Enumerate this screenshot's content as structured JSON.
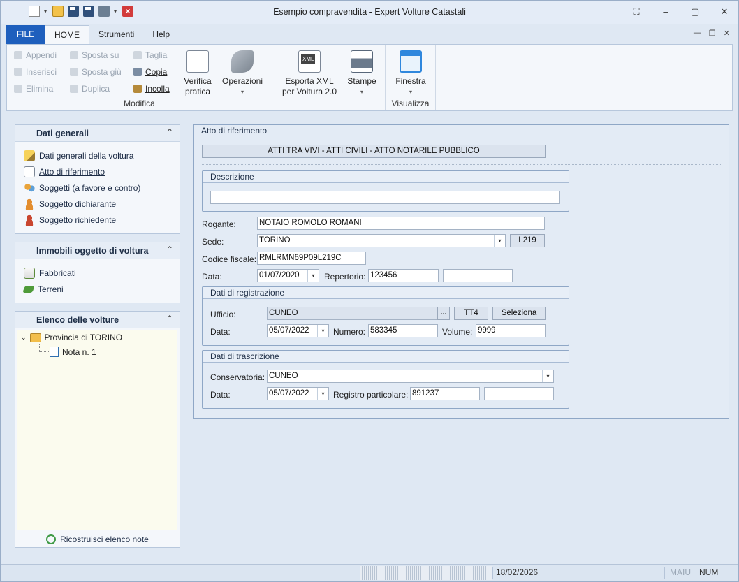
{
  "window": {
    "title": "Esempio compravendita - Expert Volture Catastali"
  },
  "ribbon_tabs": [
    "FILE",
    "HOME",
    "Strumenti",
    "Help"
  ],
  "ribbon": {
    "modifica": {
      "label": "Modifica",
      "appendi": "Appendi",
      "inserisci": "Inserisci",
      "elimina": "Elimina",
      "sposta_su": "Sposta su",
      "sposta_giu": "Sposta giù",
      "duplica": "Duplica",
      "taglia": "Taglia",
      "copia": "Copia",
      "incolla": "Incolla",
      "verifica_1": "Verifica",
      "verifica_2": "pratica",
      "operazioni": "Operazioni"
    },
    "export": {
      "esporta_1": "Esporta XML",
      "esporta_2": "per Voltura 2.0",
      "stampe": "Stampe"
    },
    "visualizza": {
      "label": "Visualizza",
      "finestra": "Finestra"
    }
  },
  "left_pane": {
    "dati_generali": {
      "title": "Dati generali",
      "items": [
        "Dati generali della voltura",
        "Atto di riferimento",
        "Soggetti (a favore e contro)",
        "Soggetto dichiarante",
        "Soggetto richiedente"
      ]
    },
    "immobili": {
      "title": "Immobili oggetto di voltura",
      "items": [
        "Fabbricati",
        "Terreni"
      ]
    },
    "elenco": {
      "title": "Elenco delle volture",
      "province": "Provincia di TORINO",
      "note": "Nota n. 1",
      "rebuild": "Ricostruisci elenco note"
    }
  },
  "form": {
    "section_title": "Atto di riferimento",
    "atto_type": "ATTI TRA VIVI - ATTI CIVILI - ATTO NOTARILE PUBBLICO",
    "descrizione": {
      "legend": "Descrizione",
      "value": ""
    },
    "rogante": {
      "label": "Rogante:",
      "value": "NOTAIO ROMOLO ROMANI"
    },
    "sede": {
      "label": "Sede:",
      "value": "TORINO",
      "code": "L219"
    },
    "codice_fiscale": {
      "label": "Codice fiscale:",
      "value": "RMLRMN69P09L219C"
    },
    "data": {
      "label": "Data:",
      "value": "01/07/2020"
    },
    "repertorio": {
      "label": "Repertorio:",
      "value": "123456",
      "extra": ""
    },
    "registrazione": {
      "legend": "Dati di registrazione",
      "ufficio_label": "Ufficio:",
      "ufficio": "CUNEO",
      "ellipsis": "···",
      "code": "TT4",
      "seleziona": "Seleziona",
      "data_label": "Data:",
      "data": "05/07/2022",
      "numero_label": "Numero:",
      "numero": "583345",
      "volume_label": "Volume:",
      "volume": "9999"
    },
    "trascrizione": {
      "legend": "Dati di trascrizione",
      "conservatoria_label": "Conservatoria:",
      "conservatoria": "CUNEO",
      "data_label": "Data:",
      "data": "05/07/2022",
      "registro_label": "Registro particolare:",
      "registro": "891237",
      "extra": ""
    }
  },
  "status": {
    "date": "18/02/2026",
    "maiu": "MAIU",
    "num": "NUM"
  }
}
